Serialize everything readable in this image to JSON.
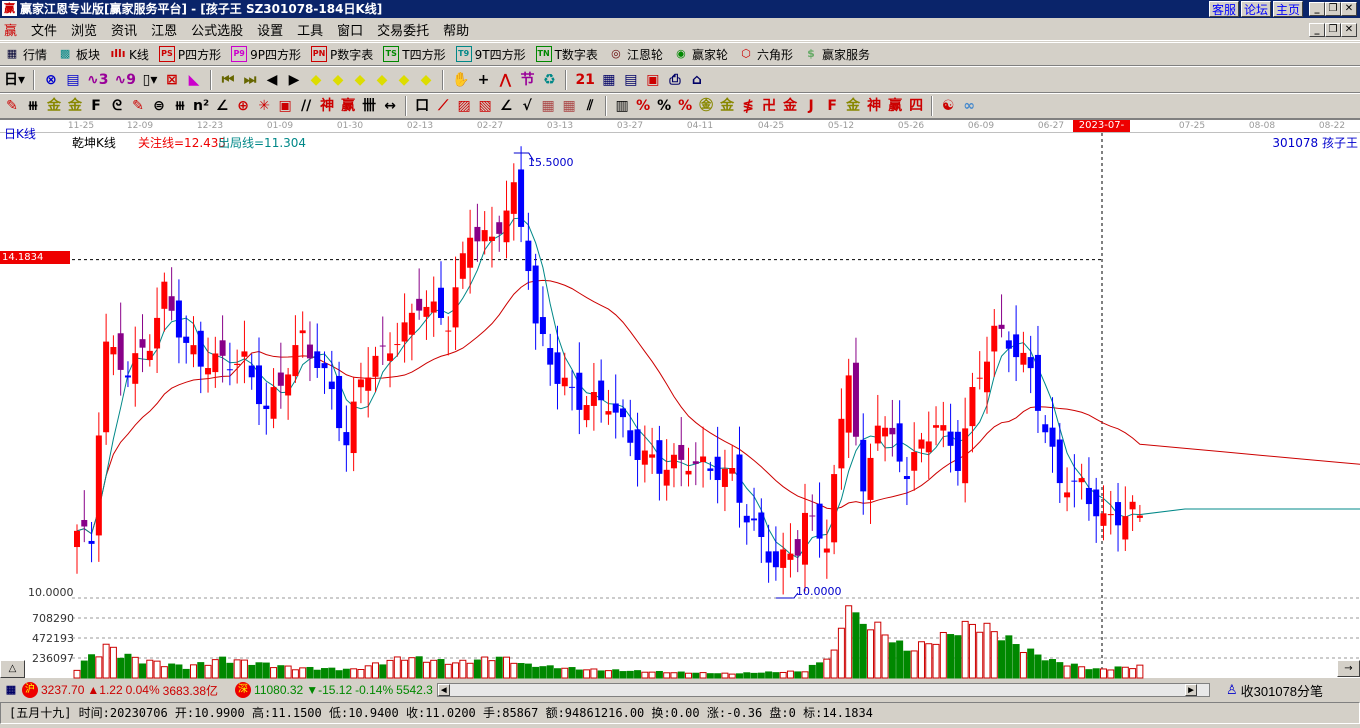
{
  "window": {
    "title": "赢家江恩专业版[赢家服务平台] - [孩子王   SZ301078-184日K线]",
    "logo": "赢",
    "links": [
      "客服",
      "论坛",
      "主页"
    ]
  },
  "menu": [
    "文件",
    "浏览",
    "资讯",
    "江恩",
    "公式选股",
    "设置",
    "工具",
    "窗口",
    "交易委托",
    "帮助"
  ],
  "toolbar1": [
    {
      "label": "行情",
      "icon": "quote-table-icon",
      "glyph": "▦",
      "color": "#003"
    },
    {
      "label": "板块",
      "icon": "sector-grid-icon",
      "glyph": "▩",
      "color": "#088"
    },
    {
      "label": "K线",
      "icon": "kline-icon",
      "glyph": "ıllı",
      "color": "#c00"
    },
    {
      "label": "P四方形",
      "icon": "ps-icon",
      "glyph": "PS",
      "color": "#c00",
      "box": true
    },
    {
      "label": "9P四方形",
      "icon": "p9-icon",
      "glyph": "P9",
      "color": "#c0c",
      "box": true
    },
    {
      "label": "P数字表",
      "icon": "pn-icon",
      "glyph": "PN",
      "color": "#c00",
      "box": true
    },
    {
      "label": "T四方形",
      "icon": "ts-icon",
      "glyph": "TS",
      "color": "#080",
      "box": true
    },
    {
      "label": "9T四方形",
      "icon": "t9-icon",
      "glyph": "T9",
      "color": "#088",
      "box": true
    },
    {
      "label": "T数字表",
      "icon": "tn-icon",
      "glyph": "TN",
      "color": "#080",
      "box": true
    },
    {
      "label": "江恩轮",
      "icon": "gann-wheel-icon",
      "glyph": "◎",
      "color": "#600"
    },
    {
      "label": "赢家轮",
      "icon": "winner-wheel-icon",
      "glyph": "◉",
      "color": "#080"
    },
    {
      "label": "六角形",
      "icon": "hexagon-icon",
      "glyph": "⬡",
      "color": "#c00"
    },
    {
      "label": "赢家服务",
      "icon": "dollar-icon",
      "glyph": "$",
      "color": "#6a6"
    }
  ],
  "toolbar2": [
    {
      "n": "period-day-select",
      "g": "日▾",
      "c": "#000"
    },
    {
      "sep": 1
    },
    {
      "n": "overlay-icon",
      "g": "⊗",
      "c": "#00c"
    },
    {
      "n": "notes-icon",
      "g": "▤",
      "c": "#00c"
    },
    {
      "n": "wave3-icon",
      "g": "∿3",
      "c": "#909"
    },
    {
      "n": "wave9-icon",
      "g": "∿9",
      "c": "#909"
    },
    {
      "n": "candle-select-icon",
      "g": "▯▾",
      "c": "#000"
    },
    {
      "n": "pattern-icon",
      "g": "⊠",
      "c": "#c00"
    },
    {
      "n": "flag-icon",
      "g": "◣",
      "c": "#c0c"
    },
    {
      "sep": 1
    },
    {
      "n": "first-icon",
      "g": "⏮",
      "c": "#660"
    },
    {
      "n": "last-icon",
      "g": "⏭",
      "c": "#660"
    },
    {
      "n": "prev-icon",
      "g": "◀",
      "c": "#000"
    },
    {
      "n": "next-icon",
      "g": "▶",
      "c": "#000"
    },
    {
      "n": "diamond-left-icon",
      "g": "◆",
      "c": "#dd0"
    },
    {
      "n": "diamond-right-icon",
      "g": "◆",
      "c": "#dd0"
    },
    {
      "n": "diamond-both-icon",
      "g": "◆",
      "c": "#dd0"
    },
    {
      "n": "diamond-x-icon",
      "g": "◆",
      "c": "#dd0"
    },
    {
      "n": "diamond-star-icon",
      "g": "◆",
      "c": "#dd0"
    },
    {
      "n": "diamond-cross-icon",
      "g": "◆",
      "c": "#dd0"
    },
    {
      "sep": 1
    },
    {
      "n": "hand-icon",
      "g": "✋",
      "c": "#000"
    },
    {
      "n": "crosshair-icon",
      "g": "+",
      "c": "#000"
    },
    {
      "n": "line-draw-icon",
      "g": "⋀",
      "c": "#c00"
    },
    {
      "n": "festival-icon",
      "g": "节",
      "c": "#909"
    },
    {
      "n": "cycle-icon",
      "g": "♻",
      "c": "#088"
    },
    {
      "sep": 1
    },
    {
      "n": "calendar-icon",
      "g": "21",
      "c": "#c00"
    },
    {
      "n": "calculator-icon",
      "g": "▦",
      "c": "#006"
    },
    {
      "n": "report-icon",
      "g": "▤",
      "c": "#006"
    },
    {
      "n": "save-icon",
      "g": "▣",
      "c": "#c00"
    },
    {
      "n": "print-icon",
      "g": "⎙",
      "c": "#006"
    },
    {
      "n": "network-icon",
      "g": "⌂",
      "c": "#006"
    }
  ],
  "toolbar3": [
    {
      "n": "pencil-icon",
      "g": "✎",
      "c": "#c00"
    },
    {
      "n": "parallel-icon",
      "g": "⧻",
      "c": "#000"
    },
    {
      "n": "gold-split-icon",
      "g": "金",
      "c": "#880"
    },
    {
      "n": "gold-split2-icon",
      "g": "金",
      "c": "#880"
    },
    {
      "n": "fib-icon",
      "g": "F",
      "c": "#000"
    },
    {
      "n": "spiral-icon",
      "g": "ᘓ",
      "c": "#000"
    },
    {
      "n": "fan-icon",
      "g": "✎",
      "c": "#c00"
    },
    {
      "n": "circle-grid-icon",
      "g": "⊜",
      "c": "#000"
    },
    {
      "n": "lines-icon",
      "g": "⧻",
      "c": "#000"
    },
    {
      "n": "n2-icon",
      "g": "n²",
      "c": "#000"
    },
    {
      "n": "angle-icon",
      "g": "∠",
      "c": "#000"
    },
    {
      "n": "target-icon",
      "g": "⊕",
      "c": "#c00"
    },
    {
      "n": "star-target-icon",
      "g": "✳",
      "c": "#c00"
    },
    {
      "n": "square-target-icon",
      "g": "▣",
      "c": "#c00"
    },
    {
      "n": "slash-icon",
      "g": "//",
      "c": "#000"
    },
    {
      "n": "shen-icon",
      "g": "神",
      "c": "#c00"
    },
    {
      "n": "ying-icon",
      "g": "赢",
      "c": "#c00"
    },
    {
      "n": "comb-icon",
      "g": "卌",
      "c": "#000"
    },
    {
      "n": "measure-icon",
      "g": "↔",
      "c": "#000"
    },
    {
      "sep": 1
    },
    {
      "n": "box-icon",
      "g": "口",
      "c": "#000"
    },
    {
      "n": "gann-fan-icon",
      "g": "⟋",
      "c": "#c00"
    },
    {
      "n": "gann-box-icon",
      "g": "▨",
      "c": "#c00"
    },
    {
      "n": "gann-grid-icon",
      "g": "▧",
      "c": "#c00"
    },
    {
      "n": "angle2-icon",
      "g": "∠",
      "c": "#000"
    },
    {
      "n": "zigzag-icon",
      "g": "√",
      "c": "#000"
    },
    {
      "n": "grid-icon",
      "g": "▦",
      "c": "#a44"
    },
    {
      "n": "grid2-icon",
      "g": "▦",
      "c": "#a44"
    },
    {
      "n": "hatch-icon",
      "g": "⫽",
      "c": "#000"
    },
    {
      "sep": 1
    },
    {
      "n": "bars-icon",
      "g": "▥",
      "c": "#000"
    },
    {
      "n": "pct-slash-icon",
      "g": "%",
      "c": "#c00"
    },
    {
      "n": "percent-icon",
      "g": "%",
      "c": "#000"
    },
    {
      "n": "pct-lines-icon",
      "g": "%",
      "c": "#c00"
    },
    {
      "n": "gold-circle-icon",
      "g": "㊎",
      "c": "#880"
    },
    {
      "n": "gold-lines-icon",
      "g": "金",
      "c": "#880"
    },
    {
      "n": "fan-bar-icon",
      "g": "≸",
      "c": "#c00"
    },
    {
      "n": "square-wave-icon",
      "g": "卍",
      "c": "#c00"
    },
    {
      "n": "gold-bar-icon",
      "g": "金",
      "c": "#c00"
    },
    {
      "n": "j-angle-icon",
      "g": "J",
      "c": "#c00"
    },
    {
      "n": "f-angle-icon",
      "g": "F",
      "c": "#c00"
    },
    {
      "n": "gold-angle-icon",
      "g": "金",
      "c": "#880"
    },
    {
      "n": "shen-angle-icon",
      "g": "神",
      "c": "#c00"
    },
    {
      "n": "ying-angle-icon",
      "g": "赢",
      "c": "#c00"
    },
    {
      "n": "si-angle-icon",
      "g": "四",
      "c": "#c00"
    },
    {
      "sep": 1
    },
    {
      "n": "yinyang-icon",
      "g": "☯",
      "c": "#c00"
    },
    {
      "n": "infinity-icon",
      "g": "∞",
      "c": "#48c"
    }
  ],
  "chart": {
    "period_label": "日K线",
    "indicator_name": "乾坤K线",
    "focus_line": "关注线=12.435",
    "exit_line": "出局线=11.304",
    "stock_label": "301078 孩子王",
    "crosshair_price": "14.1834",
    "high_marker": "15.5000",
    "low_marker": "10.0000",
    "price_axis_label": "10.0000",
    "volume_ticks": [
      "708290",
      "472193",
      "236097"
    ],
    "current_date": "2023-07-06",
    "date_ticks": [
      "11-25",
      "12-09",
      "12-23",
      "01-09",
      "01-30",
      "02-13",
      "02-27",
      "03-13",
      "03-27",
      "04-11",
      "04-25",
      "05-12",
      "05-26",
      "06-09",
      "06-27",
      "07-25",
      "08-08",
      "08-22"
    ],
    "volume_toggle": "△",
    "scroll_right": "→"
  },
  "chart_data": {
    "type": "candlestick",
    "bar_count": 147,
    "price_range": [
      10.0,
      15.5
    ],
    "volume_tick_step": 236097,
    "close_keypoints": [
      [
        0,
        10.83
      ],
      [
        2,
        10.7
      ],
      [
        3,
        12.12
      ],
      [
        4,
        13.11
      ],
      [
        7,
        12.8
      ],
      [
        10,
        13.17
      ],
      [
        12,
        13.79
      ],
      [
        15,
        13.11
      ],
      [
        17,
        12.93
      ],
      [
        23,
        12.93
      ],
      [
        26,
        12.31
      ],
      [
        31,
        13.23
      ],
      [
        35,
        12.56
      ],
      [
        37,
        11.88
      ],
      [
        39,
        12.74
      ],
      [
        45,
        13.3
      ],
      [
        47,
        13.67
      ],
      [
        51,
        13.42
      ],
      [
        54,
        14.53
      ],
      [
        57,
        14.41
      ],
      [
        60,
        15.02
      ],
      [
        62,
        14.16
      ],
      [
        63,
        13.36
      ],
      [
        66,
        12.74
      ],
      [
        69,
        12.43
      ],
      [
        73,
        12.43
      ],
      [
        77,
        11.81
      ],
      [
        80,
        11.63
      ],
      [
        84,
        11.69
      ],
      [
        90,
        11.51
      ],
      [
        92,
        11.01
      ],
      [
        96,
        10.4
      ],
      [
        99,
        10.64
      ],
      [
        100,
        11.01
      ],
      [
        103,
        10.7
      ],
      [
        104,
        11.44
      ],
      [
        106,
        12.86
      ],
      [
        108,
        11.2
      ],
      [
        110,
        12.25
      ],
      [
        114,
        11.57
      ],
      [
        118,
        12.19
      ],
      [
        121,
        11.69
      ],
      [
        123,
        12.49
      ],
      [
        126,
        13.3
      ],
      [
        128,
        13.17
      ],
      [
        131,
        12.8
      ],
      [
        133,
        12.06
      ],
      [
        135,
        11.44
      ],
      [
        138,
        11.38
      ],
      [
        141,
        10.95
      ],
      [
        145,
        11.07
      ],
      [
        146,
        11.02
      ]
    ],
    "volume_keypoints": [
      [
        0,
        120000
      ],
      [
        3,
        330000
      ],
      [
        4,
        380000
      ],
      [
        8,
        230000
      ],
      [
        15,
        130000
      ],
      [
        20,
        230000
      ],
      [
        30,
        120000
      ],
      [
        38,
        100000
      ],
      [
        45,
        250000
      ],
      [
        52,
        180000
      ],
      [
        58,
        250000
      ],
      [
        62,
        150000
      ],
      [
        70,
        100000
      ],
      [
        80,
        70000
      ],
      [
        90,
        50000
      ],
      [
        100,
        80000
      ],
      [
        104,
        300000
      ],
      [
        106,
        944000
      ],
      [
        107,
        700000
      ],
      [
        110,
        600000
      ],
      [
        114,
        330000
      ],
      [
        118,
        450000
      ],
      [
        123,
        650000
      ],
      [
        126,
        560000
      ],
      [
        130,
        350000
      ],
      [
        134,
        200000
      ],
      [
        140,
        100000
      ],
      [
        146,
        140000
      ]
    ]
  },
  "status": {
    "sh_badge": "沪",
    "sh_index": "3237.70",
    "sh_change": "▲1.22",
    "sh_pct": "0.04%",
    "sh_amount": "3683.38亿",
    "sz_badge": "深",
    "sz_index": "11080.32",
    "sz_change": "▼-15.12",
    "sz_pct": "-0.14%",
    "sz_amount": "5542.3",
    "tick_label": "收301078分笔",
    "info": "[五月十九] 时间:20230706 开:10.9900 高:11.1500 低:10.9400 收:11.0200 手:85867 额:94861216.00 换:0.00 涨:-0.36 盘:0 标:14.1834"
  }
}
